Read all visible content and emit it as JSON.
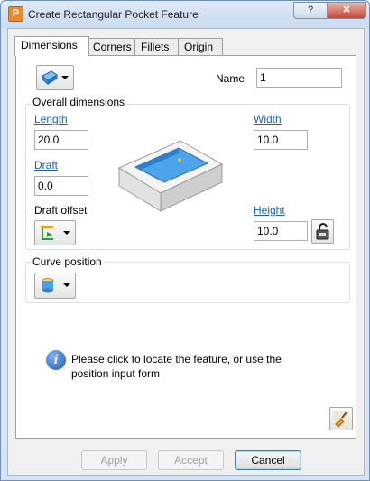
{
  "window": {
    "app_icon_letter": "P",
    "title": "Create Rectangular Pocket Feature",
    "help_label": "?",
    "close_label": "✕"
  },
  "tabs": [
    {
      "label": "Dimensions",
      "active": true
    },
    {
      "label": "Corners",
      "active": false
    },
    {
      "label": "Fillets",
      "active": false
    },
    {
      "label": "Origin",
      "active": false
    }
  ],
  "dimensions": {
    "type_dropdown_icon": "rectangular-pocket-icon",
    "name_label": "Name",
    "name_value": "1",
    "overall_title": "Overall dimensions",
    "length_label": "Length",
    "length_value": "20.0",
    "width_label": "Width",
    "width_value": "10.0",
    "draft_label": "Draft",
    "draft_value": "0.0",
    "draft_offset_label": "Draft offset",
    "draft_offset_icon": "draft-offset-icon",
    "height_label": "Height",
    "height_value": "10.0",
    "height_lock_icon": "lock-icon",
    "preview_icon": "pocket-preview-image",
    "curve_title": "Curve position",
    "curve_icon": "cylinder-position-icon",
    "info_text_line1": "Please click to locate the feature, or use the",
    "info_text_line2": "position input form",
    "pick_icon": "brush-pick-icon"
  },
  "buttons": {
    "apply": "Apply",
    "accept": "Accept",
    "cancel": "Cancel"
  },
  "colors": {
    "link": "#1a63b5",
    "pocket_blue": "#3a8fd8"
  }
}
